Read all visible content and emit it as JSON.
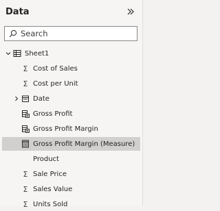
{
  "pane": {
    "title": "Data",
    "search_placeholder": "Search"
  },
  "tree": {
    "table": {
      "label": "Sheet1",
      "icon": "table-icon"
    },
    "fields": [
      {
        "label": "Cost of Sales",
        "icon": "sigma-icon"
      },
      {
        "label": "Cost per Unit",
        "icon": "sigma-icon"
      },
      {
        "label": "Date",
        "icon": "calendar-icon",
        "expandable": true
      },
      {
        "label": "Gross Profit",
        "icon": "calculated-column-icon"
      },
      {
        "label": "Gross Profit Margin",
        "icon": "calculated-column-icon"
      },
      {
        "label": "Gross Profit Margin (Measure)",
        "icon": "measure-icon",
        "selected": true
      },
      {
        "label": "Product",
        "icon": "none"
      },
      {
        "label": "Sale Price",
        "icon": "sigma-icon"
      },
      {
        "label": "Sales Value",
        "icon": "sigma-icon"
      },
      {
        "label": "Units Sold",
        "icon": "sigma-icon"
      }
    ]
  },
  "colors": {
    "pane_bg": "#f6f5f4",
    "selected_row": "#d2d0ce",
    "text": "#252423"
  }
}
